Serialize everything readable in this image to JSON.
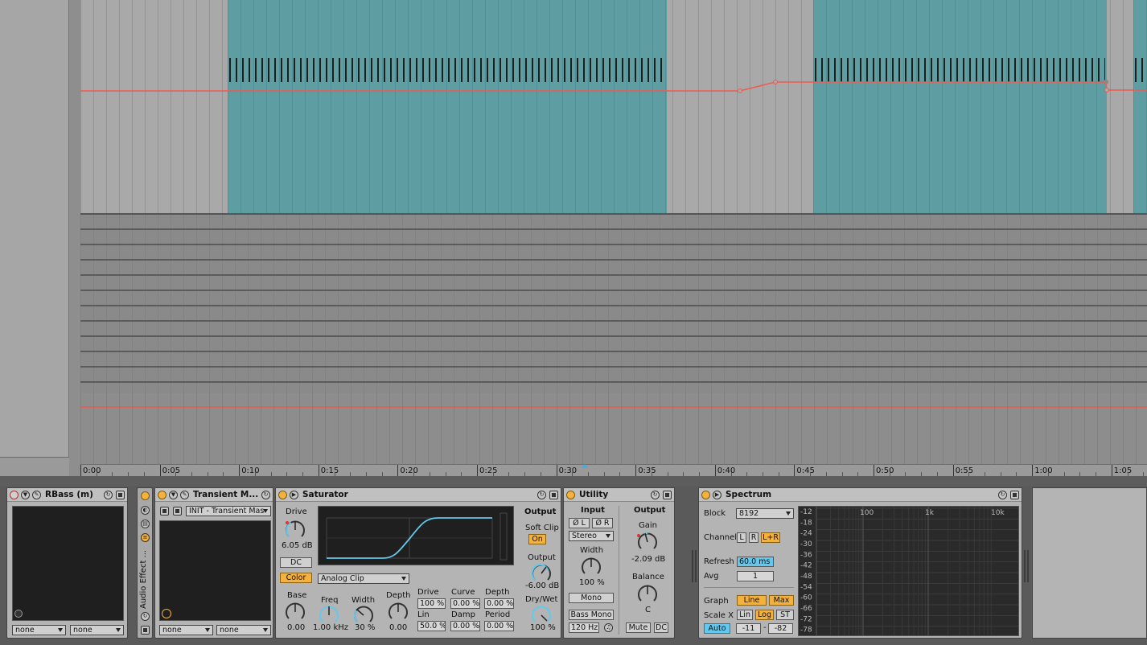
{
  "timeline": {
    "ruler_labels": [
      "0:00",
      "0:05",
      "0:10",
      "0:15",
      "0:20",
      "0:25",
      "0:30",
      "0:35",
      "0:40",
      "0:45",
      "0:50",
      "0:55",
      "1:00",
      "1:05"
    ]
  },
  "colors": {
    "clip": "#5e9ea3",
    "automation": "#f05a4f",
    "device_on": "#f6b13a",
    "knob_blue": "#63c8ee"
  },
  "devices": {
    "rbass": {
      "title": "RBass (m)",
      "select_left": "none",
      "select_right": "none"
    },
    "rack": {
      "label": "Audio Effect ..."
    },
    "transient": {
      "title": "Transient M...",
      "preset": "INIT - Transient Mas",
      "select_left": "none",
      "select_right": "none"
    },
    "saturator": {
      "title": "Saturator",
      "drive_label": "Drive",
      "drive_value": "6.05 dB",
      "dc_label": "DC",
      "color_label": "Color",
      "mode": "Analog Clip",
      "output_label": "Output",
      "soft_clip_label": "Soft Clip",
      "soft_clip_value": "On",
      "output_knob_label": "Output",
      "output_value": "-6.00 dB",
      "drywet_label": "Dry/Wet",
      "drywet_value": "100 %",
      "base_label": "Base",
      "base_value": "0.00",
      "freq_label": "Freq",
      "freq_value": "1.00 kHz",
      "width_label": "Width",
      "width_value": "30 %",
      "depth_label": "Depth",
      "depth_value": "0.00",
      "ws_drive_label": "Drive",
      "ws_drive_value": "100 %",
      "curve_label": "Curve",
      "curve_value": "0.00 %",
      "ws_depth_label": "Depth",
      "ws_depth_value": "0.00 %",
      "lin_label": "Lin",
      "lin_value": "50.0 %",
      "damp_label": "Damp",
      "damp_value": "0.00 %",
      "period_label": "Period",
      "period_value": "0.00 %"
    },
    "utility": {
      "title": "Utility",
      "input_label": "Input",
      "phase_l": "Ø L",
      "phase_r": "Ø R",
      "channel_mode": "Stereo",
      "width_label": "Width",
      "width_value": "100 %",
      "mono_label": "Mono",
      "bass_mono_label": "Bass Mono",
      "bass_mono_freq": "120 Hz",
      "output_label": "Output",
      "gain_label": "Gain",
      "gain_value": "-2.09 dB",
      "balance_label": "Balance",
      "balance_value": "C",
      "mute_label": "Mute",
      "dc_label": "DC"
    },
    "spectrum": {
      "title": "Spectrum",
      "block_label": "Block",
      "block_value": "8192",
      "channel_label": "Channel",
      "channel_l": "L",
      "channel_r": "R",
      "channel_lr": "L+R",
      "refresh_label": "Refresh",
      "refresh_value": "60.0 ms",
      "avg_label": "Avg",
      "avg_value": "1",
      "graph_label": "Graph",
      "graph_line": "Line",
      "graph_max": "Max",
      "scalex_label": "Scale X",
      "scale_lin": "Lin",
      "scale_log": "Log",
      "scale_st": "ST",
      "auto_label": "Auto",
      "range_min": "-11",
      "range_max": "-82",
      "db_labels": [
        "-12",
        "-18",
        "-24",
        "-30",
        "-36",
        "-42",
        "-48",
        "-54",
        "-60",
        "-66",
        "-72",
        "-78"
      ],
      "freq_labels": [
        "100",
        "1k",
        "10k"
      ]
    }
  }
}
